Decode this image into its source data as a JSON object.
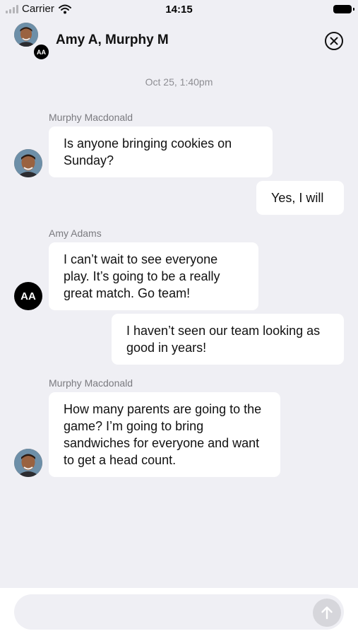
{
  "status_bar": {
    "carrier": "Carrier",
    "time": "14:15"
  },
  "header": {
    "title": "Amy A, Murphy M",
    "group_avatar_initials": "AA",
    "close_icon": "close-circle-icon"
  },
  "conversation": {
    "timestamp": "Oct 25, 1:40pm",
    "messages": [
      {
        "sender": "Murphy Macdonald",
        "text": "Is anyone bringing cookies on Sunday?",
        "direction": "incoming"
      },
      {
        "text": "Yes, I will",
        "direction": "outgoing"
      },
      {
        "sender": "Amy Adams",
        "text": "I can’t wait to see everyone play. It’s going to be a really great match. Go team!",
        "direction": "incoming",
        "avatar_initials": "AA"
      },
      {
        "text": "I haven’t seen our team looking as good in years!",
        "direction": "outgoing"
      },
      {
        "sender": "Murphy Macdonald",
        "text": "How many parents are going to the game? I’m going to bring sandwiches for everyone and want to get a head count.",
        "direction": "incoming"
      }
    ]
  },
  "composer": {
    "placeholder": "",
    "send_icon": "arrow-up-icon"
  },
  "colors": {
    "background": "#efeff4",
    "bubble": "#ffffff",
    "meta_text": "#8e8e93",
    "send_button": "#d6d6db"
  }
}
